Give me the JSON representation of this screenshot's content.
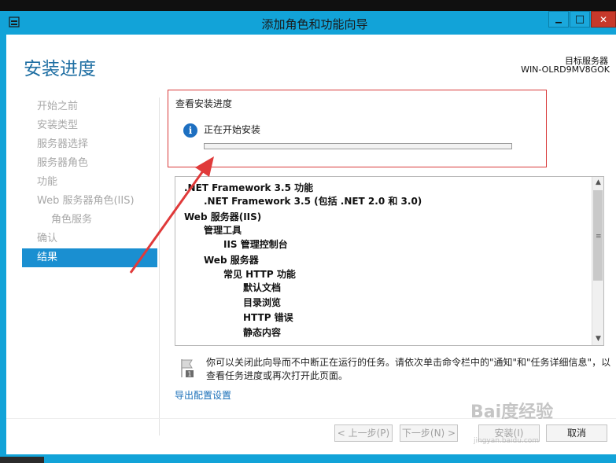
{
  "window": {
    "title": "添加角色和功能向导",
    "minimize_glyph": "▁",
    "maximize_glyph": "□",
    "close_glyph": "✕"
  },
  "header": {
    "page_title": "安装进度",
    "target_server_label": "目标服务器",
    "target_server_name": "WIN-OLRD9MV8GOK"
  },
  "nav": {
    "items": [
      {
        "label": "开始之前",
        "active": false,
        "sub": false
      },
      {
        "label": "安装类型",
        "active": false,
        "sub": false
      },
      {
        "label": "服务器选择",
        "active": false,
        "sub": false
      },
      {
        "label": "服务器角色",
        "active": false,
        "sub": false
      },
      {
        "label": "功能",
        "active": false,
        "sub": false
      },
      {
        "label": "Web 服务器角色(IIS)",
        "active": false,
        "sub": false
      },
      {
        "label": "角色服务",
        "active": false,
        "sub": true
      },
      {
        "label": "确认",
        "active": false,
        "sub": false
      },
      {
        "label": "结果",
        "active": true,
        "sub": false
      }
    ]
  },
  "progress": {
    "section_title": "查看安装进度",
    "status_text": "正在开始安装",
    "info_glyph": "i",
    "fraction": 0.0,
    "fill_color": "#3aa84a"
  },
  "features": [
    {
      "label": ".NET Framework 3.5 功能",
      "level": 0
    },
    {
      "label": ".NET Framework 3.5 (包括 .NET 2.0 和 3.0)",
      "level": 1
    },
    {
      "label": "Web 服务器(IIS)",
      "level": 0
    },
    {
      "label": "管理工具",
      "level": 1
    },
    {
      "label": "IIS 管理控制台",
      "level": 2
    },
    {
      "label": "Web 服务器",
      "level": 1
    },
    {
      "label": "常见 HTTP 功能",
      "level": 2
    },
    {
      "label": "默认文档",
      "level": 3
    },
    {
      "label": "目录浏览",
      "level": 3
    },
    {
      "label": "HTTP 错误",
      "level": 3
    },
    {
      "label": "静态内容",
      "level": 3
    }
  ],
  "scrollbar": {
    "up_glyph": "▲",
    "down_glyph": "▼",
    "grip_glyph": "≡"
  },
  "notice": {
    "text": "你可以关闭此向导而不中断正在运行的任务。请依次单击命令栏中的\"通知\"和\"任务详细信息\"，以查看任务进度或再次打开此页面。",
    "badge": "1"
  },
  "links": {
    "export": "导出配置设置"
  },
  "buttons": {
    "prev": "< 上一步(P)",
    "next": "下一步(N) >",
    "install": "安装(I)",
    "cancel": "取消"
  },
  "watermark": {
    "text": "Bai度经验",
    "url": "jingyan.baidu.com"
  },
  "colors": {
    "title_bar": "#12a3d8",
    "active_nav": "#1a8fd1",
    "heading": "#1f6fa3",
    "highlight_border": "#d93a3a",
    "annotation_arrow": "#e03a3a"
  }
}
